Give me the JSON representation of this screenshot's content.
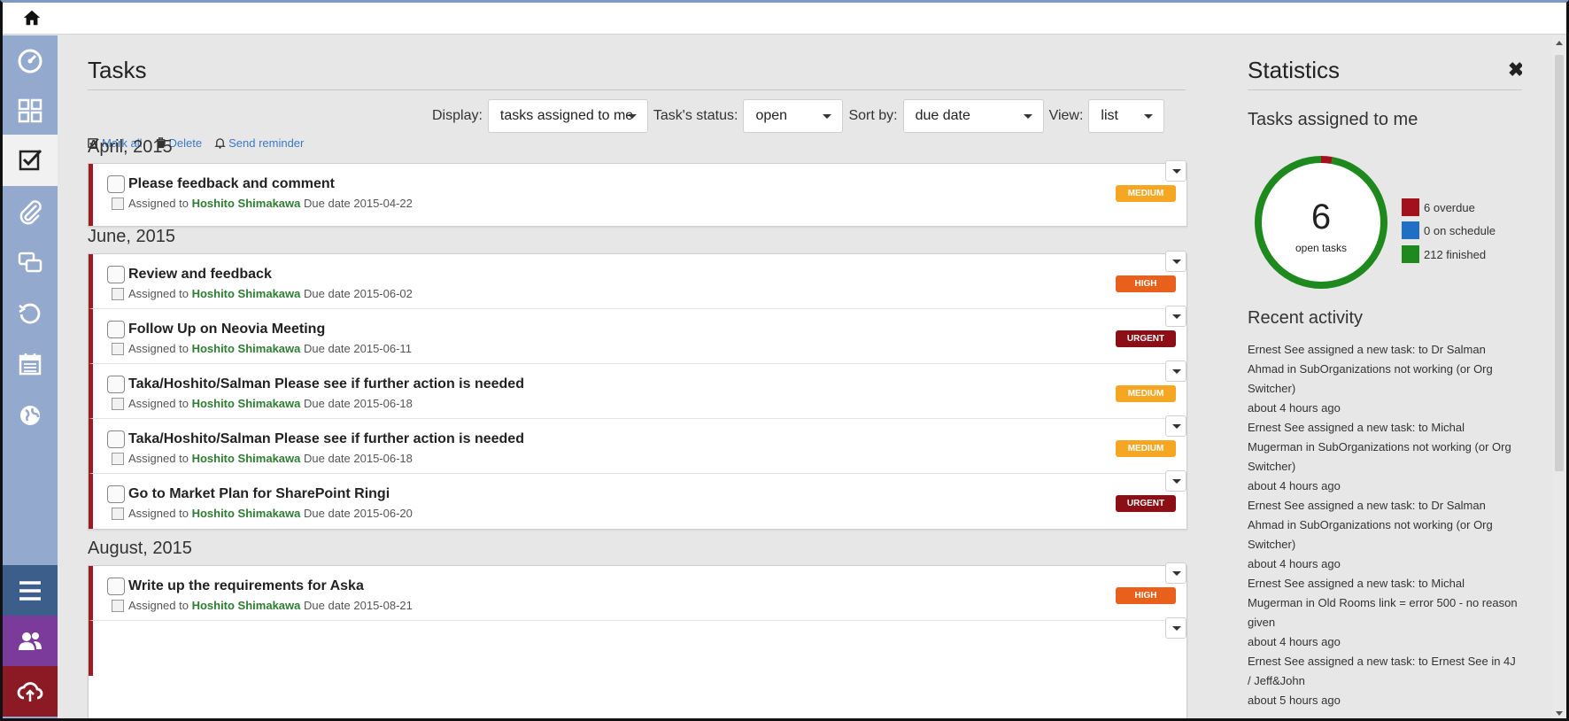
{
  "topbar": {
    "home_icon": "home-icon"
  },
  "nav": {
    "items": [
      {
        "name": "dashboard-icon"
      },
      {
        "name": "apps-grid-icon"
      },
      {
        "name": "tasks-icon",
        "active": true
      },
      {
        "name": "attachment-icon"
      },
      {
        "name": "conversations-icon"
      },
      {
        "name": "history-icon"
      },
      {
        "name": "calendar-icon"
      },
      {
        "name": "globe-icon"
      }
    ],
    "bottom": [
      {
        "name": "menu-icon",
        "color": "#3b5f8a"
      },
      {
        "name": "users-icon",
        "color": "#7a3b9a"
      },
      {
        "name": "cloud-icon",
        "color": "#8b1a24"
      }
    ]
  },
  "main": {
    "title": "Tasks",
    "filters": {
      "display_label": "Display:",
      "display_value": "tasks assigned to me",
      "status_label": "Task's status:",
      "status_value": "open",
      "sort_label": "Sort by:",
      "sort_value": "due date",
      "view_label": "View:",
      "view_value": "list"
    },
    "actions": {
      "mark_all": "Mark all",
      "delete": "Delete",
      "send_reminder": "Send reminder"
    },
    "groups": [
      {
        "month": "April, 2015",
        "tasks": [
          {
            "name": "Please feedback and comment",
            "assigned_prefix": "Assigned to",
            "assignee": "Hoshito Shimakawa",
            "due_prefix": "Due date",
            "due": "2015-04-22",
            "priority": "MEDIUM"
          }
        ]
      },
      {
        "month": "June, 2015",
        "tasks": [
          {
            "name": "Review and feedback",
            "assigned_prefix": "Assigned to",
            "assignee": "Hoshito Shimakawa",
            "due_prefix": "Due date",
            "due": "2015-06-02",
            "priority": "HIGH"
          },
          {
            "name": "Follow Up on Neovia Meeting",
            "assigned_prefix": "Assigned to",
            "assignee": "Hoshito Shimakawa",
            "due_prefix": "Due date",
            "due": "2015-06-11",
            "priority": "URGENT"
          },
          {
            "name": "Taka/Hoshito/Salman Please see if further action is needed",
            "assigned_prefix": "Assigned to",
            "assignee": "Hoshito Shimakawa",
            "due_prefix": "Due date",
            "due": "2015-06-18",
            "priority": "MEDIUM"
          },
          {
            "name": "Taka/Hoshito/Salman Please see if further action is needed",
            "assigned_prefix": "Assigned to",
            "assignee": "Hoshito Shimakawa",
            "due_prefix": "Due date",
            "due": "2015-06-18",
            "priority": "MEDIUM"
          },
          {
            "name": "Go to Market Plan for SharePoint Ringi",
            "assigned_prefix": "Assigned to",
            "assignee": "Hoshito Shimakawa",
            "due_prefix": "Due date",
            "due": "2015-06-20",
            "priority": "URGENT"
          }
        ]
      },
      {
        "month": "August, 2015",
        "tasks": [
          {
            "name": "Write up the requirements for Aska",
            "assigned_prefix": "Assigned to",
            "assignee": "Hoshito Shimakawa",
            "due_prefix": "Due date",
            "due": "2015-08-21",
            "priority": "HIGH"
          }
        ]
      }
    ],
    "priority_colors": {
      "MEDIUM": "#f5a623",
      "HIGH": "#e8601c",
      "URGENT": "#8b0f15"
    }
  },
  "stats": {
    "title": "Statistics",
    "close_icon": "close-icon",
    "subtitle": "Tasks assigned to me",
    "open_count": "6",
    "open_label": "open tasks",
    "legend": [
      {
        "label": "6 overdue",
        "value": 6,
        "color": "#a3121c"
      },
      {
        "label": "0 on schedule",
        "value": 0,
        "color": "#1f6fc5"
      },
      {
        "label": "212 finished",
        "value": 212,
        "color": "#1e8a1e"
      }
    ],
    "recent_title": "Recent activity",
    "activity": [
      {
        "text": "Ernest See assigned a new task: to Dr Salman Ahmad in SubOrganizations not working (or Org Switcher)",
        "ago": "about 4 hours ago"
      },
      {
        "text": "Ernest See assigned a new task: to Michal Mugerman in SubOrganizations not working (or Org Switcher)",
        "ago": "about 4 hours ago"
      },
      {
        "text": "Ernest See assigned a new task: to Dr Salman Ahmad in SubOrganizations not working (or Org Switcher)",
        "ago": "about 4 hours ago"
      },
      {
        "text": "Ernest See assigned a new task: to Michal Mugerman in Old Rooms link = error 500 - no reason given",
        "ago": "about 4 hours ago"
      },
      {
        "text": "Ernest See assigned a new task: to Ernest See in 4J / Jeff&John",
        "ago": "about 5 hours ago"
      }
    ]
  }
}
